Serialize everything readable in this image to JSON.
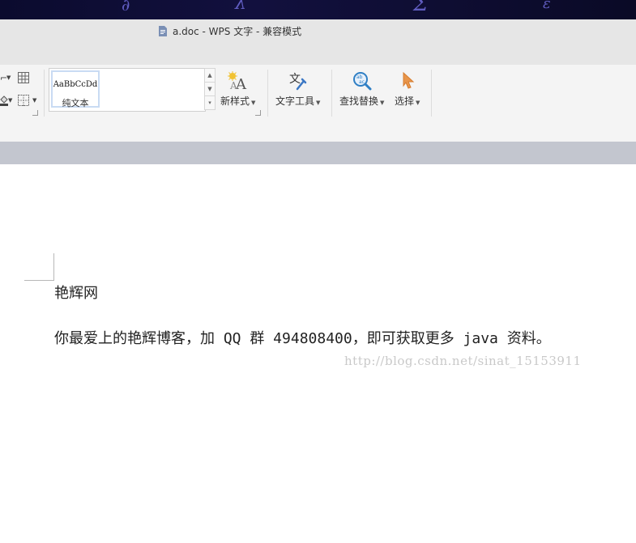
{
  "window": {
    "title": "a.doc - WPS 文字 - 兼容模式"
  },
  "ribbon": {
    "style_gallery": {
      "sample": "AaBbCcDd",
      "name": "纯文本"
    },
    "tools": [
      {
        "label": "新样式",
        "icon": "new-style-icon"
      },
      {
        "label": "文字工具",
        "icon": "text-tools-icon"
      },
      {
        "label": "查找替换",
        "icon": "find-replace-icon"
      },
      {
        "label": "选择",
        "icon": "select-cursor-icon"
      }
    ]
  },
  "document": {
    "paragraphs": [
      "艳辉网",
      "你最爱上的艳辉博客，加 QQ 群 494808400，即可获取更多 java 资料。"
    ]
  },
  "watermark": "http://blog.csdn.net/sinat_15153911",
  "colors": {
    "titlebar_bg": "#e6e6e6",
    "toolbar_bg": "#f4f4f4",
    "ribbon_bottom": "#c3c6cf",
    "select_icon": "#e8954a",
    "find_icon": "#2f7fc4"
  }
}
